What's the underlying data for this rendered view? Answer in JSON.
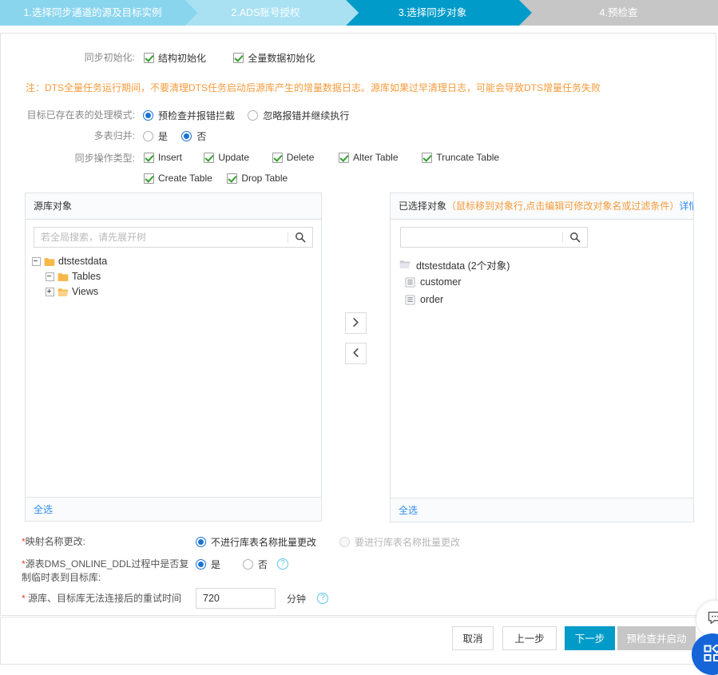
{
  "steps": [
    {
      "label": "1.选择同步通道的源及目标实例",
      "state": "done"
    },
    {
      "label": "2.ADS账号授权",
      "state": "done"
    },
    {
      "label": "3.选择同步对象",
      "state": "active"
    },
    {
      "label": "4.预检查",
      "state": "pending"
    }
  ],
  "form": {
    "init_label": "同步初始化:",
    "init_options": [
      {
        "label": "结构初始化",
        "checked": true
      },
      {
        "label": "全量数据初始化",
        "checked": true
      }
    ],
    "note": "注：DTS全量任务运行期间，不要清理DTS任务启动后源库产生的增量数据日志。源库如果过早清理日志，可能会导致DTS增量任务失败",
    "exist_mode_label": "目标已存在表的处理模式:",
    "exist_mode_options": [
      {
        "label": "预检查并报错拦截",
        "selected": true
      },
      {
        "label": "忽略报错并继续执行",
        "selected": false
      }
    ],
    "merge_label": "多表归并:",
    "merge_options": [
      {
        "label": "是",
        "selected": false
      },
      {
        "label": "否",
        "selected": true
      }
    ],
    "op_type_label": "同步操作类型:",
    "op_type_options": [
      {
        "label": "Insert",
        "checked": true
      },
      {
        "label": "Update",
        "checked": true
      },
      {
        "label": "Delete",
        "checked": true
      },
      {
        "label": "Alter Table",
        "checked": true
      },
      {
        "label": "Truncate Table",
        "checked": true
      },
      {
        "label": "Create Table",
        "checked": true
      },
      {
        "label": "Drop Table",
        "checked": true
      }
    ]
  },
  "source_panel": {
    "title": "源库对象",
    "search_placeholder": "若全局搜索，请先展开树",
    "search_value": "",
    "search_icon": "search-icon",
    "tree": [
      {
        "label": "dtstestdata",
        "level": 1,
        "expander": "minus",
        "icon": "folder-closed-icon"
      },
      {
        "label": "Tables",
        "level": 2,
        "expander": "minus",
        "icon": "folder-closed-icon"
      },
      {
        "label": "Views",
        "level": 2,
        "expander": "plus",
        "icon": "folder-open-icon"
      }
    ],
    "select_all": "全选"
  },
  "target_panel": {
    "title": "已选择对象",
    "title_hint": "（鼠标移到对象行,点击编辑可修改对象名或过滤条件）",
    "title_link": "详情点我",
    "search_placeholder": "",
    "search_value": "",
    "search_icon": "search-icon",
    "items": [
      {
        "label": "dtstestdata (2个对象)",
        "icon": "folder-open-icon",
        "indent": false
      },
      {
        "label": "customer",
        "icon": "table-icon",
        "indent": true
      },
      {
        "label": "order",
        "icon": "table-icon",
        "indent": true
      }
    ],
    "select_all": "全选"
  },
  "transfer": {
    "to_right_icon": "chevron-right-icon",
    "to_left_icon": "chevron-left-icon"
  },
  "bottom_form": {
    "mapping_label_req": "*",
    "mapping_label": "映射名称更改:",
    "mapping_options": [
      {
        "label": "不进行库表名称批量更改",
        "selected": true,
        "disabled": false
      },
      {
        "label": "要进行库表名称批量更改",
        "selected": false,
        "disabled": true
      }
    ],
    "ddl_label_req": "*",
    "ddl_label_line1": "源表DMS_ONLINE_DDL过程中是否复",
    "ddl_label_line2": "制临时表到目标库:",
    "ddl_options": [
      {
        "label": "是",
        "selected": true
      },
      {
        "label": "否",
        "selected": false
      }
    ],
    "ddl_help_icon": "help-icon",
    "retry_label_req": "*",
    "retry_label": "源库、目标库无法连接后的重试时间",
    "retry_value": "720",
    "retry_unit": "分钟",
    "retry_help_icon": "help-icon"
  },
  "footer": {
    "cancel": "取消",
    "prev": "上一步",
    "next": "下一步",
    "precheck": "预检查并启动"
  },
  "float": {
    "chat_icon": "chat-bubble-icon",
    "qr_icon": "qr-code-icon"
  },
  "colors": {
    "active_step": "#009bc9",
    "done_step": "#8ad5ee",
    "done_step_2": "#a9e1f3",
    "pending_step": "#c6c6c6",
    "warning": "#f59b3c",
    "link": "#2d8cf0",
    "radio": "#1a73d4",
    "check": "#33a02c",
    "folder": "#f7b84a"
  }
}
